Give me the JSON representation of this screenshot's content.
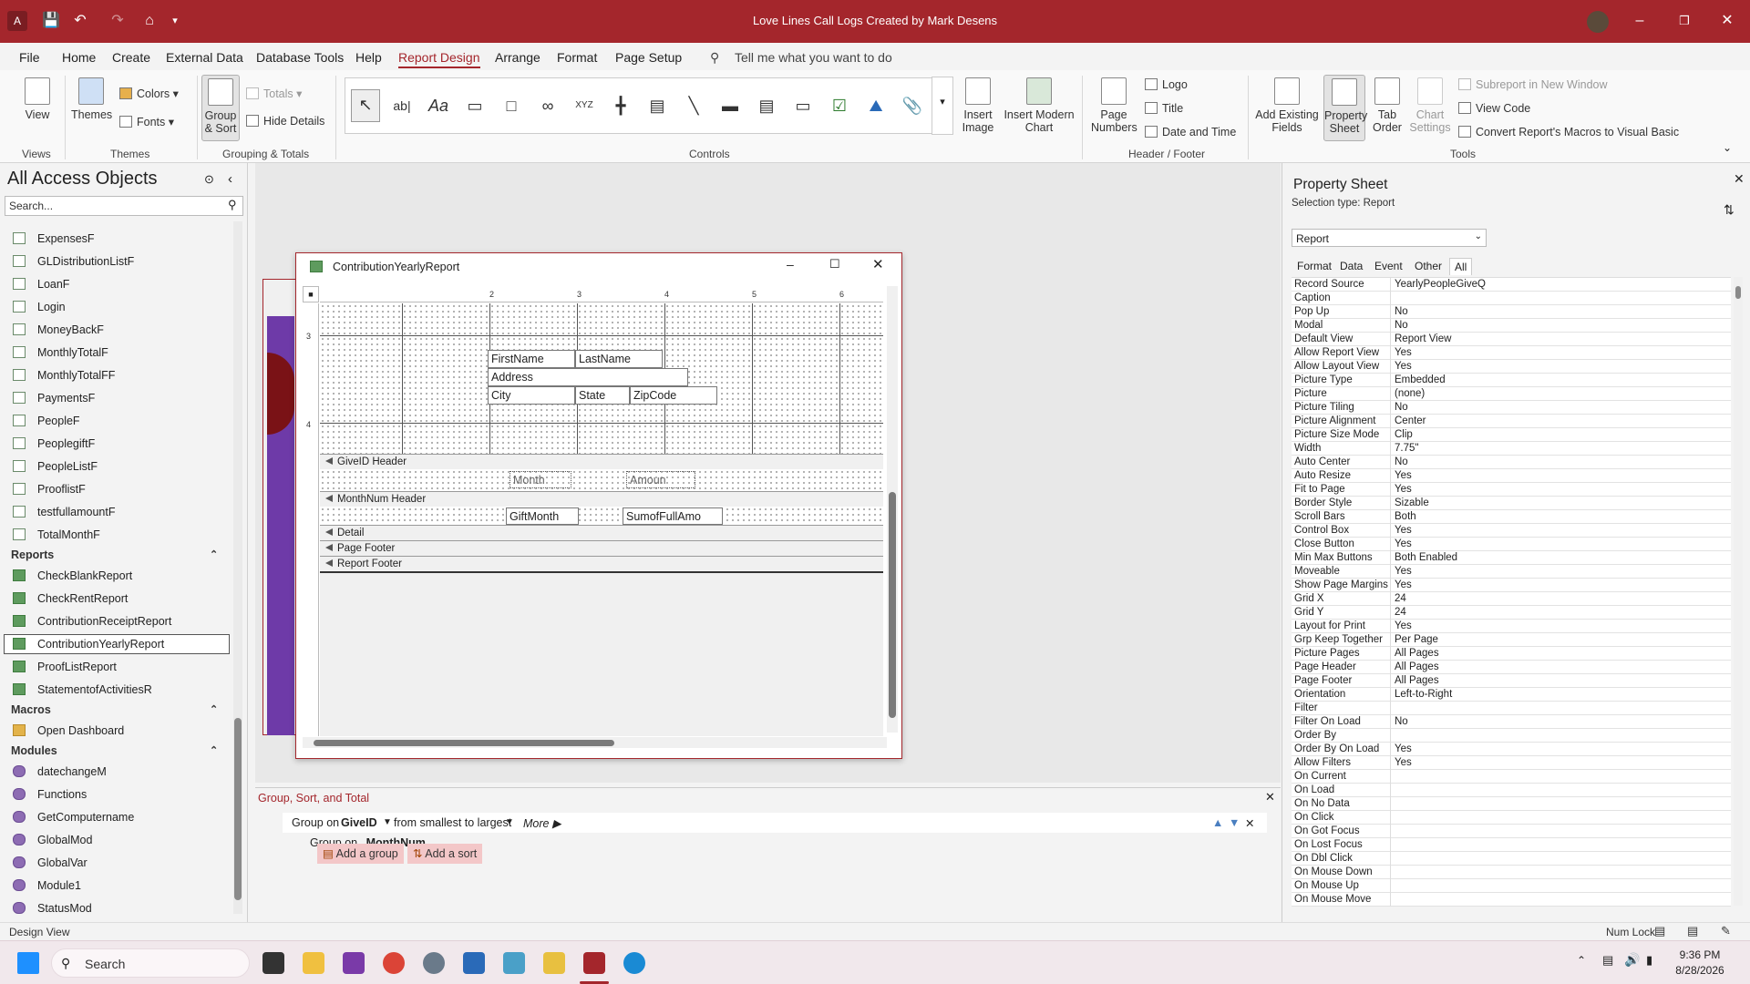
{
  "app": {
    "title": "Love Lines Call Logs Created by Mark Desens"
  },
  "menu": [
    "File",
    "Home",
    "Create",
    "External Data",
    "Database Tools",
    "Help",
    "Report Design",
    "Arrange",
    "Format",
    "Page Setup"
  ],
  "menu_active": "Report Design",
  "tell_me": "Tell me what you want to do",
  "ribbon": {
    "views": {
      "view_label": "View",
      "group": "Views"
    },
    "themes": {
      "themes_label": "Themes",
      "colors_label": "Colors",
      "fonts_label": "Fonts",
      "group": "Themes"
    },
    "grouping": {
      "group_sort_label": "Group\n& Sort",
      "totals_label": "Totals",
      "hide_details_label": "Hide Details",
      "group": "Grouping & Totals"
    },
    "controls": {
      "group": "Controls",
      "insert_image_label": "Insert\nImage",
      "insert_chart_label": "Insert Modern\nChart"
    },
    "header_footer": {
      "page_numbers_label": "Page\nNumbers",
      "logo_label": "Logo",
      "title_label": "Title",
      "date_time_label": "Date and Time",
      "group": "Header / Footer"
    },
    "tools": {
      "add_fields_label": "Add Existing\nFields",
      "property_sheet_label": "Property\nSheet",
      "tab_order_label": "Tab\nOrder",
      "chart_settings_label": "Chart\nSettings",
      "subreport_label": "Subreport in New Window",
      "view_code_label": "View Code",
      "convert_macros_label": "Convert Report's Macros to Visual Basic",
      "group": "Tools"
    }
  },
  "nav": {
    "title": "All Access Objects",
    "search_placeholder": "Search...",
    "forms": [
      "ExpensesF",
      "GLDistributionListF",
      "LoanF",
      "Login",
      "MoneyBackF",
      "MonthlyTotalF",
      "MonthlyTotalFF",
      "PaymentsF",
      "PeopleF",
      "PeoplegiftF",
      "PeopleListF",
      "ProoflistF",
      "testfullamountF",
      "TotalMonthF"
    ],
    "reports_label": "Reports",
    "reports": [
      "CheckBlankReport",
      "CheckRentReport",
      "ContributionReceiptReport",
      "ContributionYearlyReport",
      "ProofListReport",
      "StatementofActivitiesR"
    ],
    "macros_label": "Macros",
    "macros": [
      "Open Dashboard"
    ],
    "modules_label": "Modules",
    "modules": [
      "datechangeM",
      "Functions",
      "GetComputername",
      "GlobalMod",
      "GlobalVar",
      "Module1",
      "StatusMod"
    ]
  },
  "report": {
    "window_title": "ContributionYearlyReport",
    "ruler_numbers": [
      "2",
      "3",
      "4",
      "5",
      "6"
    ],
    "vruler_numbers": [
      "3",
      "4"
    ],
    "fields": {
      "firstname": "FirstName",
      "lastname": "LastName",
      "address": "Address",
      "city": "City",
      "state": "State",
      "zipcode": "ZipCode",
      "month": "Month",
      "amount": "Amoun",
      "giftmonth": "GiftMonth",
      "sumfull": "SumofFullAmo"
    },
    "sections": {
      "giveid_header": "GiveID Header",
      "monthnum_header": "MonthNum Header",
      "detail": "Detail",
      "page_footer": "Page Footer",
      "report_footer": "Report Footer"
    }
  },
  "group_sort": {
    "title": "Group, Sort, and Total",
    "row1_prefix": "Group on",
    "row1_field": "GiveID",
    "row1_order": "from smallest to largest",
    "row1_more": "More ▶",
    "row2_prefix": "Group on",
    "row2_field": "MonthNum",
    "add_group": "Add a group",
    "add_sort": "Add a sort"
  },
  "property_sheet": {
    "title": "Property Sheet",
    "selection_type": "Selection type:  Report",
    "selected": "Report",
    "tabs": [
      "Format",
      "Data",
      "Event",
      "Other",
      "All"
    ],
    "active_tab": "All",
    "rows": [
      [
        "Record Source",
        "YearlyPeopleGiveQ"
      ],
      [
        "Caption",
        ""
      ],
      [
        "Pop Up",
        "No"
      ],
      [
        "Modal",
        "No"
      ],
      [
        "Default View",
        "Report View"
      ],
      [
        "Allow Report View",
        "Yes"
      ],
      [
        "Allow Layout View",
        "Yes"
      ],
      [
        "Picture Type",
        "Embedded"
      ],
      [
        "Picture",
        "(none)"
      ],
      [
        "Picture Tiling",
        "No"
      ],
      [
        "Picture Alignment",
        "Center"
      ],
      [
        "Picture Size Mode",
        "Clip"
      ],
      [
        "Width",
        "7.75\""
      ],
      [
        "Auto Center",
        "No"
      ],
      [
        "Auto Resize",
        "Yes"
      ],
      [
        "Fit to Page",
        "Yes"
      ],
      [
        "Border Style",
        "Sizable"
      ],
      [
        "Scroll Bars",
        "Both"
      ],
      [
        "Control Box",
        "Yes"
      ],
      [
        "Close Button",
        "Yes"
      ],
      [
        "Min Max Buttons",
        "Both Enabled"
      ],
      [
        "Moveable",
        "Yes"
      ],
      [
        "Show Page Margins",
        "Yes"
      ],
      [
        "Grid X",
        "24"
      ],
      [
        "Grid Y",
        "24"
      ],
      [
        "Layout for Print",
        "Yes"
      ],
      [
        "Grp Keep Together",
        "Per Page"
      ],
      [
        "Picture Pages",
        "All Pages"
      ],
      [
        "Page Header",
        "All Pages"
      ],
      [
        "Page Footer",
        "All Pages"
      ],
      [
        "Orientation",
        "Left-to-Right"
      ],
      [
        "Filter",
        ""
      ],
      [
        "Filter On Load",
        "No"
      ],
      [
        "Order By",
        ""
      ],
      [
        "Order By On Load",
        "Yes"
      ],
      [
        "Allow Filters",
        "Yes"
      ],
      [
        "On Current",
        ""
      ],
      [
        "On Load",
        ""
      ],
      [
        "On No Data",
        ""
      ],
      [
        "On Click",
        ""
      ],
      [
        "On Got Focus",
        ""
      ],
      [
        "On Lost Focus",
        ""
      ],
      [
        "On Dbl Click",
        ""
      ],
      [
        "On Mouse Down",
        ""
      ],
      [
        "On Mouse Up",
        ""
      ],
      [
        "On Mouse Move",
        ""
      ]
    ]
  },
  "status": {
    "left": "Design View",
    "num_lock": "Num Lock"
  },
  "taskbar": {
    "search": "Search",
    "time": "9:36 PM",
    "date": "8/28/2026"
  }
}
